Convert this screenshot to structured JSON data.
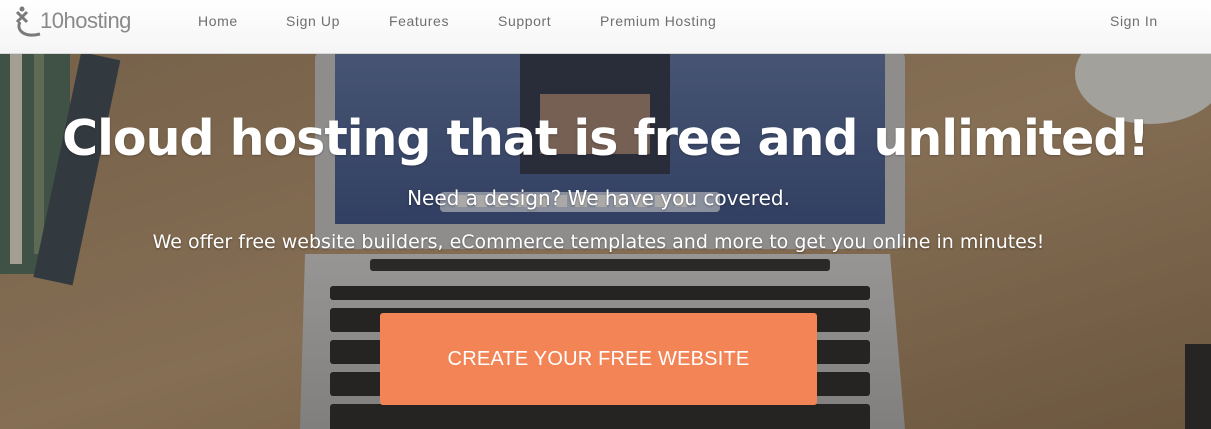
{
  "brand": {
    "name": "10hosting",
    "logo_color": "#8a8a8a"
  },
  "nav": {
    "items": [
      {
        "label": "Home"
      },
      {
        "label": "Sign Up"
      },
      {
        "label": "Features"
      },
      {
        "label": "Support"
      },
      {
        "label": "Premium Hosting"
      }
    ],
    "signin": "Sign In"
  },
  "hero": {
    "title": "Cloud hosting that is free and unlimited!",
    "subtitle": "Need a design? We have you covered.",
    "description": "We offer free website builders, eCommerce templates and more to get you online in minutes!",
    "cta_label": "CREATE YOUR FREE WEBSITE",
    "cta_color": "#f28456",
    "background_image": "laptop-on-desk-photo"
  }
}
